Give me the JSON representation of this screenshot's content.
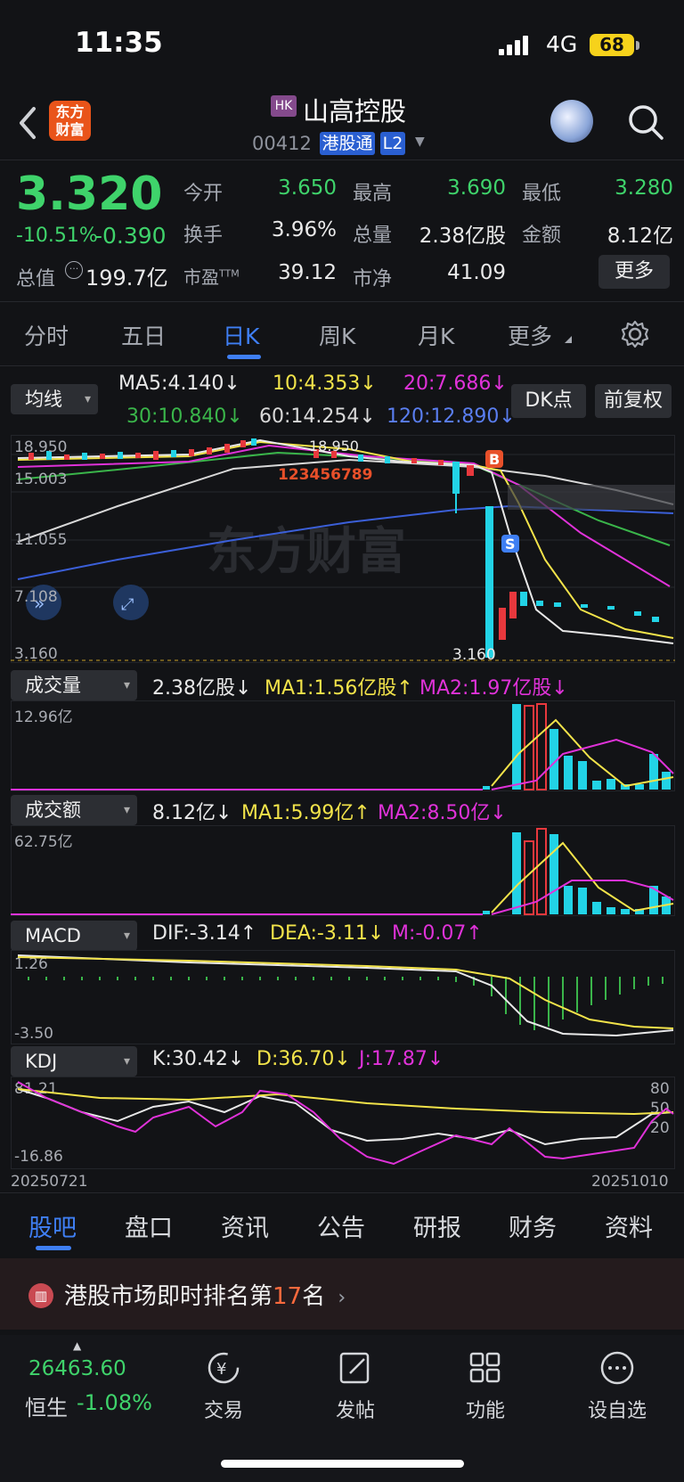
{
  "status_bar": {
    "time": "11:35",
    "network": "4G",
    "battery": "68"
  },
  "header": {
    "logo_text": "东方财富",
    "market_badge": "HK",
    "title": "山高控股",
    "code": "00412",
    "tag1": "港股通",
    "tag2": "L2"
  },
  "quote": {
    "price": "3.320",
    "change_pct": "-10.51%",
    "change": "-0.390",
    "mktcap_label": "总值",
    "mktcap": "199.7亿",
    "open_label": "今开",
    "open": "3.650",
    "high_label": "最高",
    "high": "3.690",
    "low_label": "最低",
    "low": "3.280",
    "turnover_label": "换手",
    "turnover": "3.96%",
    "volume_label": "总量",
    "volume": "2.38亿股",
    "amount_label": "金额",
    "amount": "8.12亿",
    "pe_label": "市盈",
    "pe_sup": "TTM",
    "pe": "39.12",
    "pb_label": "市净",
    "pb": "41.09",
    "more": "更多"
  },
  "period_tabs": [
    "分时",
    "五日",
    "日K",
    "周K",
    "月K",
    "更多"
  ],
  "chart_controls": {
    "ma_dropdown": "均线",
    "dk_button": "DK点",
    "adjust_button": "前复权"
  },
  "ma": {
    "ma5": "MA5:4.140↓",
    "ma10": "10:4.353↓",
    "ma20": "20:7.686↓",
    "ma30": "30:10.840↓",
    "ma60": "60:14.254↓",
    "ma120": "120:12.890↓"
  },
  "colors": {
    "up": "#e8383d",
    "down": "#22d3e6",
    "ma5": "#e8e8e8",
    "ma10": "#f2e34a",
    "ma20": "#e032d9",
    "ma30": "#3ab54a",
    "ma60": "#d8d8d8",
    "ma120": "#3b5fd8",
    "accent": "#3f7ff4"
  },
  "price_axis": [
    "18.950",
    "15.003",
    "11.055",
    "7.108",
    "3.160"
  ],
  "price_marks": {
    "high": "18.950",
    "low": "3.160"
  },
  "volume_panel": {
    "name": "成交量",
    "value": "2.38亿股↓",
    "ma1": "MA1:1.56亿股↑",
    "ma2": "MA2:1.97亿股↓",
    "axis_max": "12.96亿"
  },
  "amount_panel": {
    "name": "成交额",
    "value": "8.12亿↓",
    "ma1": "MA1:5.99亿↑",
    "ma2": "MA2:8.50亿↓",
    "axis_max": "62.75亿"
  },
  "macd_panel": {
    "name": "MACD",
    "dif": "DIF:-3.14↑",
    "dea": "DEA:-3.11↓",
    "m": "M:-0.07↑",
    "axis_max": "1.26",
    "axis_min": "-3.50"
  },
  "kdj_panel": {
    "name": "KDJ",
    "k": "K:30.42↓",
    "d": "D:36.70↓",
    "j": "J:17.87↓",
    "axis_max": "81.21",
    "axis_min": "-16.86",
    "levels": [
      "80",
      "50",
      "20"
    ]
  },
  "date_start": "20250721",
  "date_end": "20251010",
  "bottom_tabs": [
    "股吧",
    "盘口",
    "资讯",
    "公告",
    "研报",
    "财务",
    "资料"
  ],
  "banner": {
    "prefix": "港股市场即时排名第",
    "rank": "17",
    "suffix": "名"
  },
  "nav": {
    "index_value": "26463.60",
    "index_name": "恒生",
    "index_change": "-1.08%",
    "items": [
      "交易",
      "发帖",
      "功能",
      "设自选"
    ]
  }
}
